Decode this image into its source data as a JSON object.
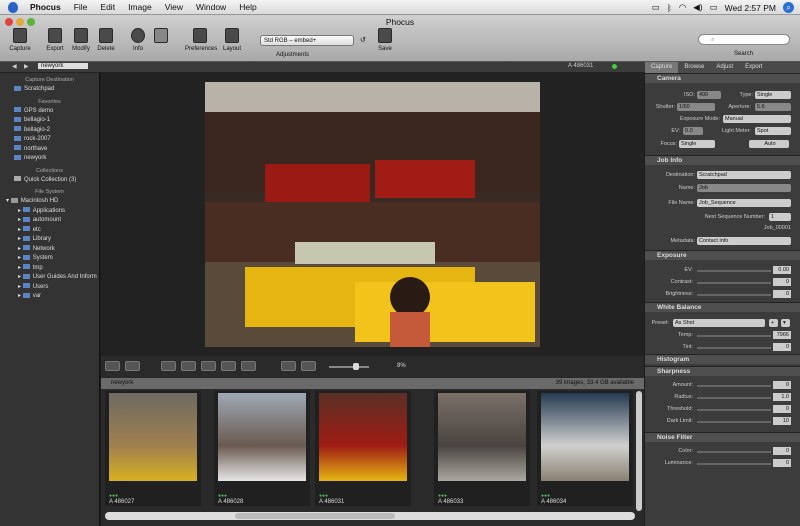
{
  "menubar": {
    "app": "Phocus",
    "items": [
      "File",
      "Edit",
      "Image",
      "View",
      "Window",
      "Help"
    ],
    "clock": "Wed 2:57 PM"
  },
  "window": {
    "title": "Phocus"
  },
  "toolbar": {
    "capture": "Capture",
    "export": "Export",
    "modify": "Modify",
    "delete": "Delete",
    "info": "Info",
    "preferences": "Preferences",
    "layout": "Layout",
    "adjustments_value": "Std RGB – embed+",
    "adjustments_label": "Adjustments",
    "save": "Save",
    "search_label": "Search"
  },
  "strip": {
    "folder": "newyork",
    "image_id": "A 486031"
  },
  "sidebar": {
    "capture_destination": "Capture Destination",
    "scratchpad": "Scratchpad",
    "favorites": "Favorites",
    "favorites_items": [
      "GPS demo",
      "bellagio-1",
      "bellagio-2",
      "rock-2007",
      "northave",
      "newyork"
    ],
    "collections": "Collections",
    "quick_collection": "Quick Collection (3)",
    "file_system": "File System",
    "disk": "Macintosh HD",
    "fs_items": [
      "Applications",
      "automount",
      "etc",
      "Library",
      "Network",
      "System",
      "tmp",
      "User Guides And Inform",
      "Users",
      "var"
    ]
  },
  "viewer": {
    "zoom": "8%"
  },
  "browser": {
    "folder": "newyork",
    "summary": "39 images, 33.4 GB available",
    "thumbs": [
      "A 486027",
      "A 486028",
      "A 486031",
      "A 486033",
      "A 486034"
    ]
  },
  "right": {
    "tabs": [
      "Capture",
      "Browse",
      "Adjust",
      "Export"
    ],
    "camera": {
      "title": "Camera",
      "iso_label": "ISO:",
      "iso": "400",
      "type_label": "Type:",
      "type": "Single",
      "shutter_label": "Shutter:",
      "shutter": "1/60",
      "aperture_label": "Aperture:",
      "aperture": "5.6",
      "exposure_mode_label": "Exposure Mode:",
      "exposure_mode": "Manual",
      "ev_label": "EV:",
      "ev": "0.0",
      "light_meter_label": "Light Meter:",
      "light_meter": "Spot",
      "focus_label": "Focus:",
      "focus": "Single",
      "auto": "Auto"
    },
    "job": {
      "title": "Job Info",
      "destination_label": "Destination:",
      "destination": "Scratchpad",
      "name_label": "Name:",
      "name": "Job",
      "file_name_label": "File Name:",
      "file_name": "Job_Sequence",
      "next_seq_label": "Next Sequence Number:",
      "next_seq": "1",
      "file_example": "Job_00001",
      "metadata_label": "Metadata:",
      "metadata": "Contact info"
    },
    "exposure": {
      "title": "Exposure",
      "labels": [
        "EV:",
        "Contrast:",
        "Brightness:"
      ],
      "values": [
        "0.00",
        "0",
        "0"
      ]
    },
    "white_balance": {
      "title": "White Balance",
      "preset_label": "Preset:",
      "preset": "As Shot",
      "labels": [
        "Temp:",
        "Tint:"
      ],
      "values": [
        "7966",
        "0"
      ]
    },
    "histogram": {
      "title": "Histogram"
    },
    "sharpness": {
      "title": "Sharpness",
      "labels": [
        "Amount:",
        "Radius:",
        "Threshold:",
        "Dark Limit:"
      ],
      "values": [
        "0",
        "1.0",
        "0",
        "10"
      ]
    },
    "noise": {
      "title": "Noise Filter",
      "labels": [
        "Color:",
        "Luminance:"
      ],
      "values": [
        "0",
        "0"
      ]
    }
  }
}
